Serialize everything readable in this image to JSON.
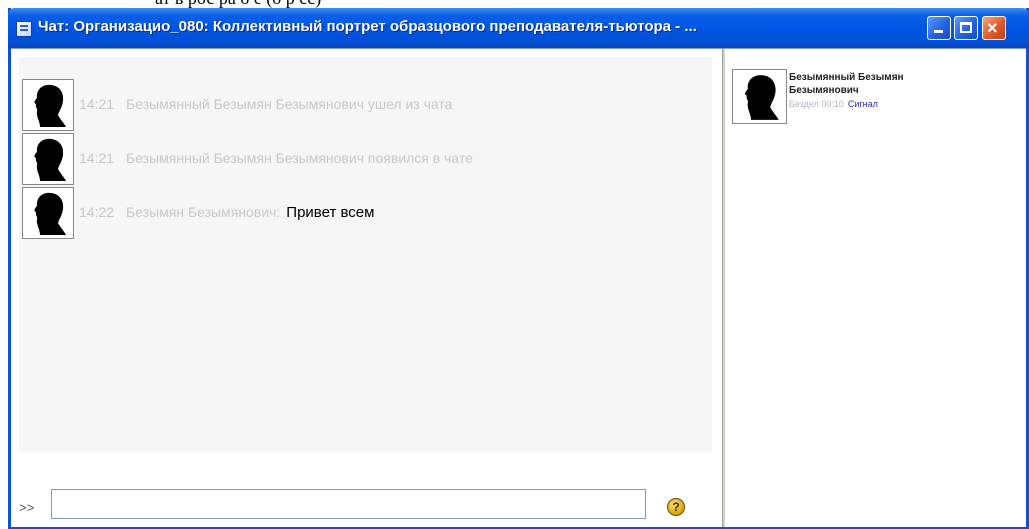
{
  "caption_fragment": "ат в рос ра о е (о р сс)",
  "window": {
    "title": "Чат: Организацио_080: Коллективный портрет образцового преподавателя-тьютора - ...",
    "min_label": "",
    "max_label": "",
    "close_label": "×"
  },
  "messages": [
    {
      "time": "14:21",
      "text": "Безымянный Безымян Безымянович ушел из чата",
      "author": "",
      "body": ""
    },
    {
      "time": "14:21",
      "text": "Безымянный Безымян Безымянович появился в чате",
      "author": "",
      "body": ""
    },
    {
      "time": "14:22",
      "text": "",
      "author": "Безымян Безымянович:",
      "body": "Привет всем"
    }
  ],
  "input": {
    "prompt": ">>",
    "value": "",
    "help_label": "?"
  },
  "users": [
    {
      "name": "Безымянный Безымян Безымянович",
      "idle": "Бездел 00:10",
      "beep_label": "Сигнал"
    }
  ],
  "colors": {
    "title_bar": "#0055e5",
    "system_text": "#c8c8c8",
    "message_text": "#000000",
    "link": "#3030b0"
  },
  "icons": {
    "avatar": "silhouette-avatar-icon",
    "help": "help-icon",
    "window": "chat-window-icon"
  }
}
